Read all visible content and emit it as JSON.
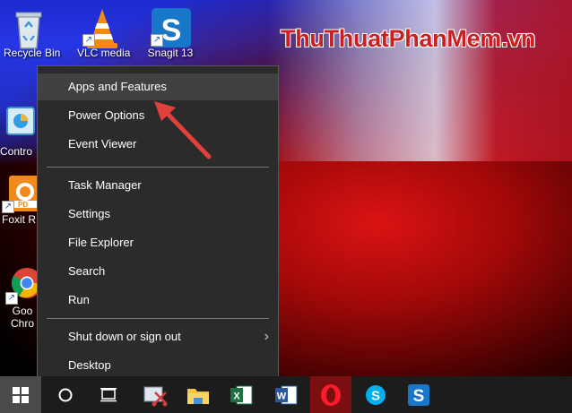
{
  "watermark": "ThuThuatPhanMem.vn",
  "desktop_icons": [
    {
      "name": "Recycle Bin"
    },
    {
      "name": "VLC media"
    },
    {
      "name": "Snagit 13"
    },
    {
      "name": "Contro"
    },
    {
      "name": "Foxit R"
    },
    {
      "name": "Goo"
    },
    {
      "name": "Chro"
    }
  ],
  "context_menu": {
    "items": [
      {
        "label": "Apps and Features"
      },
      {
        "label": "Power Options"
      },
      {
        "label": "Event Viewer"
      },
      {
        "label": "Task Manager"
      },
      {
        "label": "Settings"
      },
      {
        "label": "File Explorer"
      },
      {
        "label": "Search"
      },
      {
        "label": "Run"
      },
      {
        "label": "Shut down or sign out"
      },
      {
        "label": "Desktop"
      }
    ],
    "submenu_chevron": "›"
  },
  "taskbar": {
    "apps": [
      {
        "icon": "windows-logo-icon"
      },
      {
        "icon": "cortana-icon"
      },
      {
        "icon": "task-view-icon"
      },
      {
        "icon": "snipping-tool-icon"
      },
      {
        "icon": "file-explorer-icon"
      },
      {
        "icon": "excel-icon"
      },
      {
        "icon": "word-icon"
      },
      {
        "icon": "opera-icon"
      },
      {
        "icon": "skype-icon"
      },
      {
        "icon": "snagit-icon"
      }
    ],
    "labels": {
      "excel": "X",
      "word": "W",
      "skype": "S",
      "snagit": "S"
    }
  },
  "colors": {
    "menu_bg": "#2b2b2b",
    "highlight": "#414141",
    "arrow": "#e0413a"
  }
}
